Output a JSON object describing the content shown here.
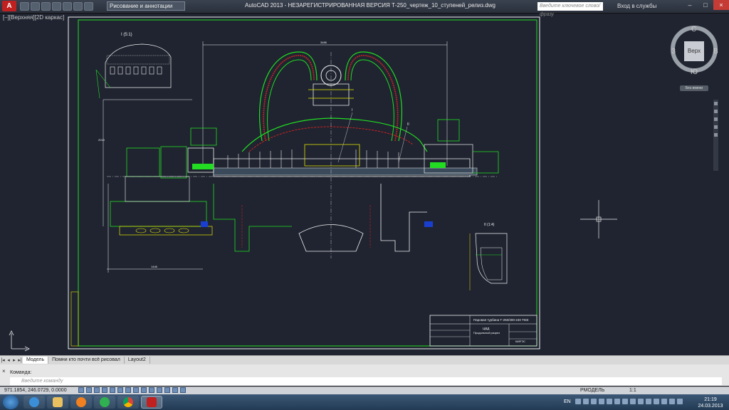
{
  "app": {
    "window_title": "AutoCAD 2013 - НЕЗАРЕГИСТРИРОВАННАЯ ВЕРСИЯ    Т-250_чертеж_10_ступеней_релиз.dwg",
    "workspace": "Рисование и аннотации",
    "search_placeholder": "Введите ключевое слово/фразу",
    "signin": "Вход в службы",
    "window_buttons": [
      "–",
      "□",
      "×"
    ]
  },
  "viewport": {
    "label": "[–][Верхняя][2D каркас]"
  },
  "drawing": {
    "detail_I_label": "I (5:1)",
    "detail_II_label": "II (1:4)",
    "leader_1": "I",
    "leader_2": "II",
    "dim_top": "3486",
    "dim_bottom": "1446",
    "dim_left": "2015",
    "title_block_line1": "Паровая турбина Т-250/300-240 ТМЗ",
    "title_block_line2": "ЦВД",
    "title_block_line3": "Продольный разрез",
    "title_block_small": "КАФТЭС",
    "accent_green": "#22dd22",
    "accent_red": "#cc2222",
    "accent_yellow": "#e8e800",
    "accent_white": "#f0f0f0",
    "accent_blue": "#1a3fd0"
  },
  "viewcube": {
    "top_label": "Верх",
    "north": "С",
    "south": "Ю",
    "west": "З",
    "east": "В",
    "wcs_label": "Без имени"
  },
  "tabs": {
    "items": [
      "Модель",
      "Помни кто почти всё рисовал",
      "Layout2"
    ]
  },
  "command": {
    "history_label": "Команда:",
    "placeholder": "Введите команду"
  },
  "status": {
    "coords": "971.1854, 246.0729, 0.0000",
    "model_label": "РМОДЕЛЬ",
    "scale": "1:1"
  },
  "taskbar": {
    "lang": "EN",
    "time": "21:19",
    "date": "24.03.2013"
  }
}
